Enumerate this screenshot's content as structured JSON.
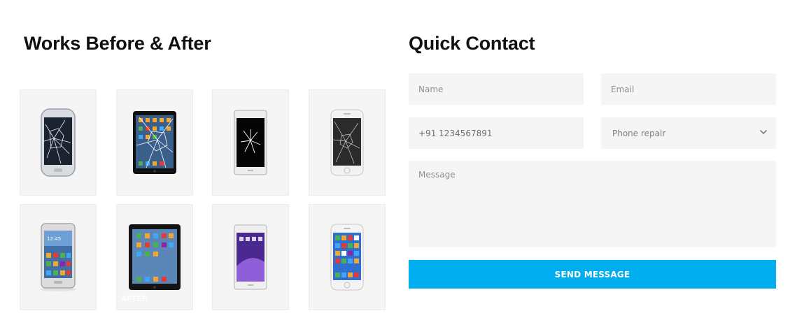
{
  "works": {
    "title": "Works Before & After",
    "tiles": [
      {
        "icon": "cracked-galaxy-phone-icon",
        "caption": ""
      },
      {
        "icon": "cracked-ipad-icon",
        "caption": ""
      },
      {
        "icon": "cracked-sony-phone-icon",
        "caption": ""
      },
      {
        "icon": "cracked-iphone-icon",
        "caption": ""
      },
      {
        "icon": "repaired-galaxy-phone-icon",
        "caption": ""
      },
      {
        "icon": "repaired-ipad-icon",
        "caption": "AFTER"
      },
      {
        "icon": "repaired-sony-phone-icon",
        "caption": ""
      },
      {
        "icon": "repaired-iphone-icon",
        "caption": ""
      }
    ]
  },
  "contact": {
    "title": "Quick Contact",
    "name_placeholder": "Name",
    "email_placeholder": "Email",
    "phone_value": "+91 1234567891",
    "service_selected": "Phone repair",
    "message_placeholder": "Message",
    "send_label": "SEND MESSAGE",
    "accent": "#00aeef"
  }
}
